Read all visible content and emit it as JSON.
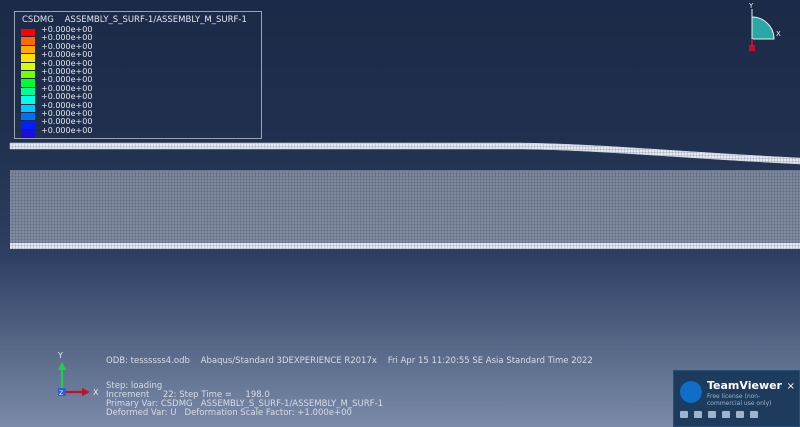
{
  "legend": {
    "variable": "CSDMG",
    "surface_pair": "ASSEMBLY_S_SURF-1/ASSEMBLY_M_SURF-1",
    "colors": [
      "#ff0000",
      "#ff6a00",
      "#ffaa00",
      "#ffe000",
      "#d4ff00",
      "#6eff00",
      "#00ff30",
      "#00ff9a",
      "#00ffe8",
      "#00c8ff",
      "#0070ff",
      "#0020ff",
      "#1a10d8"
    ],
    "values": [
      "+0.000e+00",
      "+0.000e+00",
      "+0.000e+00",
      "+0.000e+00",
      "+0.000e+00",
      "+0.000e+00",
      "+0.000e+00",
      "+0.000e+00",
      "+0.000e+00",
      "+0.000e+00",
      "+0.000e+00",
      "+0.000e+00",
      "+0.000e+00"
    ]
  },
  "triad": {
    "y_label": "Y",
    "x_label": "X"
  },
  "axes": {
    "y_label": "Y",
    "z_label": "Z",
    "x_label": "X"
  },
  "info": {
    "odb_line": "ODB: tessssss4.odb    Abaqus/Standard 3DEXPERIENCE R2017x    Fri Apr 15 11:20:55 SE Asia Standard Time 2022",
    "step_line": "Step: loading",
    "increment_line": "Increment     22: Step Time =     198.0",
    "primary_line": "Primary Var: CSDMG   ASSEMBLY_S_SURF-1/ASSEMBLY_M_SURF-1",
    "deformed_line": "Deformed Var: U   Deformation Scale Factor: +1.000e+00"
  },
  "teamviewer": {
    "name": "TeamViewer",
    "subtitle": "Free license (non-commercial use only)",
    "close": "×"
  }
}
